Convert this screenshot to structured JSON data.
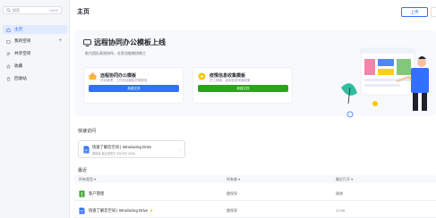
{
  "sidebar": {
    "search_placeholder": "搜索",
    "search_shortcut": "Ctrl+K",
    "items": [
      {
        "label": "主页",
        "icon": "home-icon",
        "active": true
      },
      {
        "label": "我的空间",
        "icon": "folder-icon",
        "has_add": true
      },
      {
        "label": "共享空间",
        "icon": "users-icon"
      },
      {
        "label": "收藏",
        "icon": "star-icon"
      },
      {
        "label": "回收站",
        "icon": "trash-icon"
      }
    ],
    "add_symbol": "+"
  },
  "header": {
    "title": "主页",
    "upload_label": "上传"
  },
  "banner": {
    "title": "远程协同办公模板上线",
    "subtitle": "助力团队高效协作，在家也能愉快做工",
    "cards": [
      {
        "title": "远程协同办公模板",
        "subtitle": "项目管理、工作总结模板开箱即用",
        "button": "新建文档",
        "color": "#3370ff"
      },
      {
        "title": "疫情信息收集模板",
        "subtitle": "员工健康、返岗信息快速收集",
        "button": "新建文档",
        "color": "#2ea121"
      }
    ]
  },
  "quick_access": {
    "title": "快速访问",
    "items": [
      {
        "name": "快速了解云空间 | Introducing Drive",
        "meta": "雷保泉 最近查看于 3月10日 15:56",
        "more": "..."
      }
    ]
  },
  "recent": {
    "title": "最近",
    "columns": [
      "所有类型 ▾",
      "所有者 ▾",
      "最近打开 ▾"
    ],
    "rows": [
      {
        "name": "客户管理",
        "owner": "雷保泉",
        "time": "刚刚",
        "icon": "sheet-icon",
        "starred": false
      },
      {
        "name": "快速了解云空间 | Introducing Drive",
        "owner": "雷保泉",
        "time": "17:29",
        "icon": "doc-icon",
        "starred": true
      }
    ],
    "star_symbol": "★"
  },
  "colors": {
    "accent": "#3370ff",
    "green": "#2ea121",
    "sidebar_bg": "#f5f6f7"
  }
}
